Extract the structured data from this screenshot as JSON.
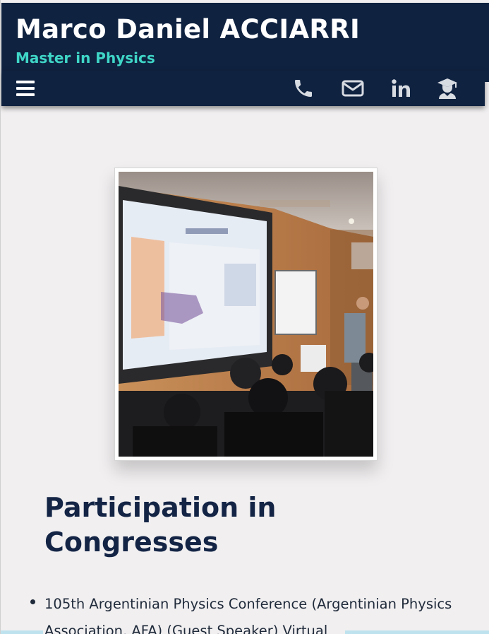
{
  "header": {
    "name": "Marco Daniel ACCIARRI",
    "subtitle": "Master in Physics"
  },
  "navbar": {
    "icons": [
      "menu-icon",
      "phone-icon",
      "envelope-icon",
      "linkedin-icon",
      "graduate-icon"
    ]
  },
  "colors": {
    "header_bg": "#0f2240",
    "subtitle": "#3fd6c7",
    "page_bg": "#f1eff0",
    "heading": "#132445"
  },
  "main": {
    "section_title": "Participation in Congresses",
    "congresses": [
      "105th Argentinian Physics Conference (Argentinian Physics Association, AFA) (Guest Speaker) Virtual"
    ]
  }
}
